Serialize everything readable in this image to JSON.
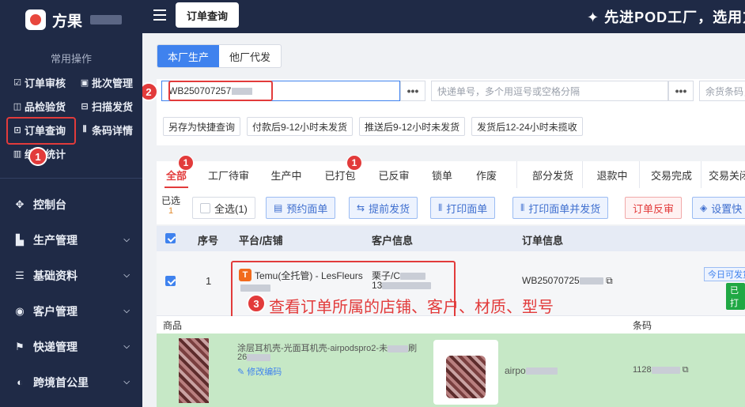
{
  "brand": {
    "name": "方果"
  },
  "sidebar": {
    "quick_title": "常用操作",
    "quick_items": [
      {
        "icon": "☑",
        "label": "订单审核"
      },
      {
        "icon": "▣",
        "label": "批次管理"
      },
      {
        "icon": "◫",
        "label": "品检验货"
      },
      {
        "icon": "⊟",
        "label": "扫描发货"
      },
      {
        "icon": "⊡",
        "label": "订单查询"
      },
      {
        "icon": "⦀",
        "label": "条码详情"
      },
      {
        "icon": "▥",
        "label": "绩效统计"
      }
    ],
    "menu": [
      {
        "icon": "✥",
        "label": "控制台"
      },
      {
        "icon": "▙",
        "label": "生产管理"
      },
      {
        "icon": "☰",
        "label": "基础资料"
      },
      {
        "icon": "◉",
        "label": "客户管理"
      },
      {
        "icon": "⚑",
        "label": "快递管理"
      },
      {
        "icon": "◐",
        "label": "跨境首公里"
      }
    ]
  },
  "topbar": {
    "active_tab": "订单查询",
    "slogan": "✦ 先进POD工厂，选用方"
  },
  "segment": {
    "own": "本厂生产",
    "other": "他厂代发"
  },
  "filters": {
    "order_no_value": "WB250707257",
    "express_placeholder": "快递单号，多个用逗号或空格分隔",
    "remain_placeholder": "余货条码，多",
    "dots": "•••",
    "chips": [
      "另存为快捷查询",
      "付款后9-12小时未发货",
      "推送后9-12小时未发货",
      "发货后12-24小时未揽收"
    ]
  },
  "status_tabs": [
    {
      "label": "全部",
      "badge": "1"
    },
    {
      "label": "工厂待审"
    },
    {
      "label": "生产中"
    },
    {
      "label": "已打包",
      "badge": "1"
    },
    {
      "label": "已反审"
    },
    {
      "label": "锁单"
    },
    {
      "label": "作废"
    },
    {
      "label": "部分发货"
    },
    {
      "label": "退款中"
    },
    {
      "label": "交易完成"
    },
    {
      "label": "交易关闭"
    }
  ],
  "toolbar": {
    "selected_label": "已选",
    "selected_count": "1",
    "select_all": "全选(1)",
    "buttons": [
      {
        "icon": "▤",
        "label": "预约面单"
      },
      {
        "icon": "⇆",
        "label": "提前发货"
      },
      {
        "icon": "⦀",
        "label": "打印面单"
      },
      {
        "icon": "⦀",
        "label": "打印面单并发货"
      },
      {
        "icon": "",
        "label": "订单反审"
      },
      {
        "icon": "◈",
        "label": "设置快"
      }
    ]
  },
  "table": {
    "headers": {
      "seq": "序号",
      "shop": "平台/店铺",
      "customer": "客户信息",
      "order": "订单信息"
    },
    "row": {
      "seq": "1",
      "shop": "Temu(全托管) - LesFleurs",
      "customer_name": "栗子/C",
      "customer_phone": "13",
      "order_no": "WB25070725",
      "tag_today": "今日可发货",
      "tag_green": "已打"
    },
    "subhead": {
      "product": "商品",
      "barcode": "条码"
    },
    "product": {
      "title": "涂层耳机壳-光面耳机壳-airpodspro2-未",
      "title_tail": "刷",
      "sku": "26",
      "edit": "修改编码",
      "model": "airpo",
      "barcode": "1128"
    }
  },
  "annotations": {
    "n1": "1",
    "n2": "2",
    "n3": "3",
    "text3": "查看订单所属的店铺、客户、材质、型号"
  },
  "colors": {
    "sidebar": "#1f2a46",
    "primary": "#3f82ee",
    "danger": "#e23b3b",
    "success": "#20a844"
  }
}
